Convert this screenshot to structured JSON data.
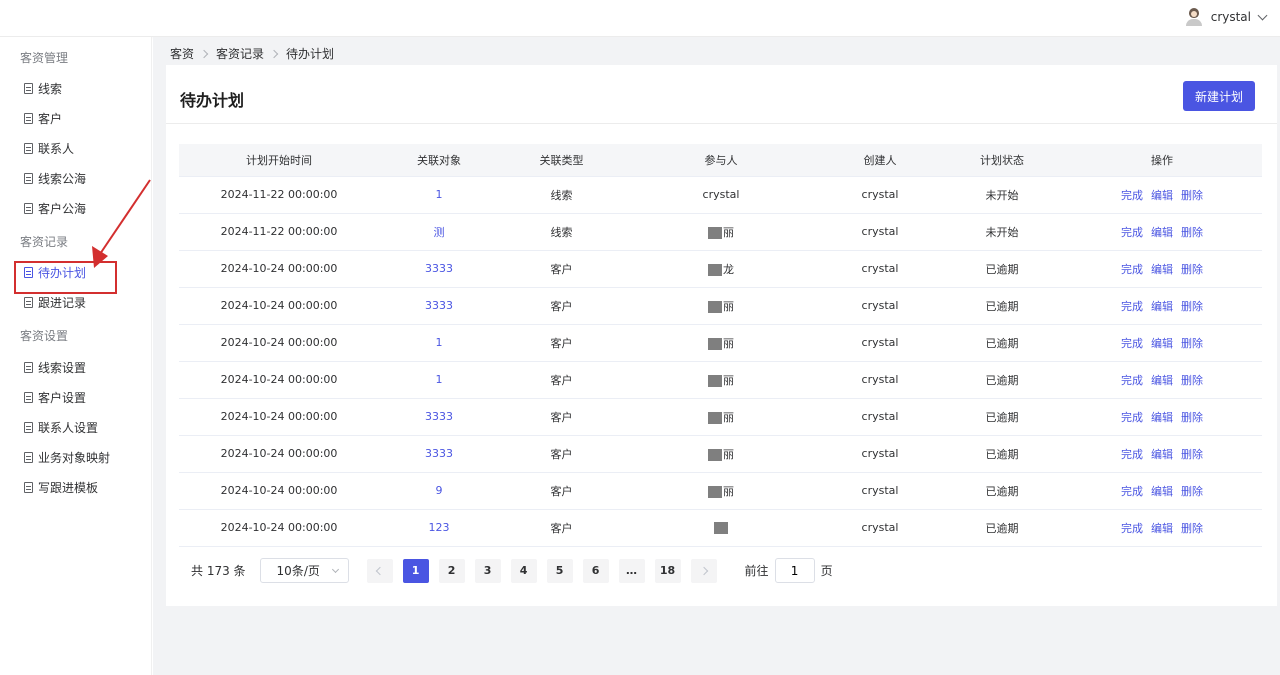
{
  "user": {
    "name": "crystal"
  },
  "sidebar": {
    "groups": [
      {
        "label": "客资管理"
      },
      {
        "label": "客资记录"
      },
      {
        "label": "客资设置"
      }
    ],
    "items": [
      {
        "label": "线索"
      },
      {
        "label": "客户"
      },
      {
        "label": "联系人"
      },
      {
        "label": "线索公海"
      },
      {
        "label": "客户公海"
      },
      {
        "label": "待办计划"
      },
      {
        "label": "跟进记录"
      },
      {
        "label": "线索设置"
      },
      {
        "label": "客户设置"
      },
      {
        "label": "联系人设置"
      },
      {
        "label": "业务对象映射"
      },
      {
        "label": "写跟进模板"
      }
    ]
  },
  "breadcrumb": [
    "客资",
    "客资记录",
    "待办计划"
  ],
  "page": {
    "title": "待办计划",
    "new_button": "新建计划"
  },
  "table": {
    "columns": [
      "计划开始时间",
      "关联对象",
      "关联类型",
      "参与人",
      "创建人",
      "计划状态",
      "操作"
    ],
    "actions": [
      "完成",
      "编辑",
      "删除"
    ],
    "rows": [
      {
        "time": "2024-11-22 00:00:00",
        "object": "1",
        "type": "线索",
        "participant": "crystal",
        "creator": "crystal",
        "status": "未开始"
      },
      {
        "time": "2024-11-22 00:00:00",
        "object": "测",
        "type": "线索",
        "participant": "丽",
        "creator": "crystal",
        "status": "未开始"
      },
      {
        "time": "2024-10-24 00:00:00",
        "object": "3333",
        "type": "客户",
        "participant": "龙",
        "creator": "crystal",
        "status": "已逾期"
      },
      {
        "time": "2024-10-24 00:00:00",
        "object": "3333",
        "type": "客户",
        "participant": "丽",
        "creator": "crystal",
        "status": "已逾期"
      },
      {
        "time": "2024-10-24 00:00:00",
        "object": "1",
        "type": "客户",
        "participant": "丽",
        "creator": "crystal",
        "status": "已逾期"
      },
      {
        "time": "2024-10-24 00:00:00",
        "object": "1",
        "type": "客户",
        "participant": "丽",
        "creator": "crystal",
        "status": "已逾期"
      },
      {
        "time": "2024-10-24 00:00:00",
        "object": "3333",
        "type": "客户",
        "participant": "丽",
        "creator": "crystal",
        "status": "已逾期"
      },
      {
        "time": "2024-10-24 00:00:00",
        "object": "3333",
        "type": "客户",
        "participant": "丽",
        "creator": "crystal",
        "status": "已逾期"
      },
      {
        "time": "2024-10-24 00:00:00",
        "object": "9",
        "type": "客户",
        "participant": "丽",
        "creator": "crystal",
        "status": "已逾期"
      },
      {
        "time": "2024-10-24 00:00:00",
        "object": "123",
        "type": "客户",
        "participant": "",
        "creator": "crystal",
        "status": "已逾期"
      }
    ]
  },
  "pagination": {
    "total_label": "共 173 条",
    "page_size": "10条/页",
    "pages": [
      "1",
      "2",
      "3",
      "4",
      "5",
      "6",
      "…",
      "18"
    ],
    "goto_prefix": "前往",
    "goto_value": "1",
    "goto_suffix": "页"
  },
  "colors": {
    "accent": "#4a55e2",
    "annotation": "#d32f2f"
  },
  "icons": [
    "user-avatar-icon",
    "chevron-down-icon",
    "document-icon",
    "chevron-right-icon",
    "chevron-left-icon"
  ]
}
